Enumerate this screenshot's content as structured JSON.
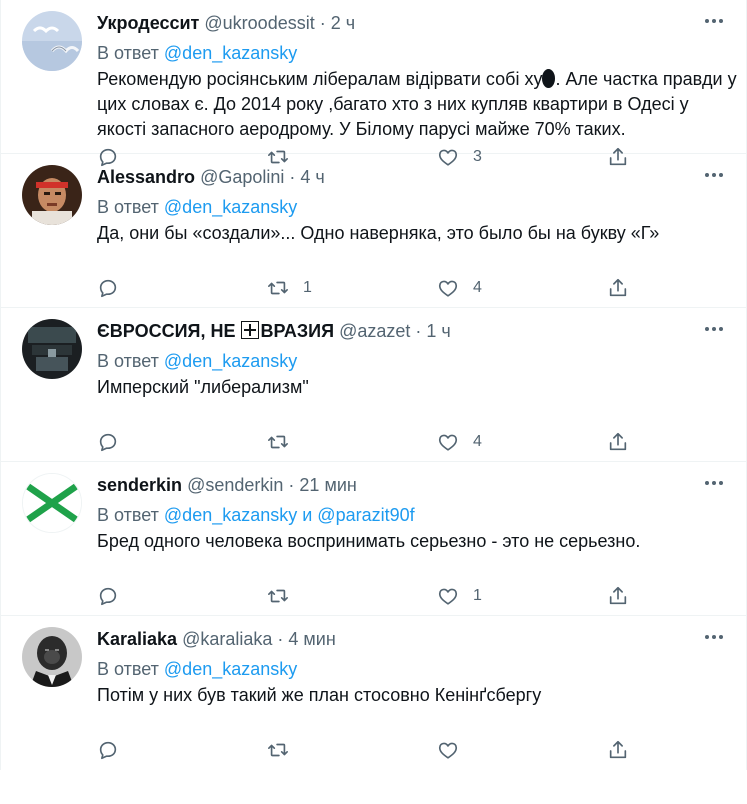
{
  "colors": {
    "accent": "#1d9bf0",
    "secondary_text": "#536471",
    "primary_text": "#0f1419",
    "divider": "#eff3f4"
  },
  "reply_prefix": "В ответ",
  "tweets": [
    {
      "name": "Укродессит",
      "handle": "@ukroodessit",
      "dot": "·",
      "time": "2 ч",
      "mentions": "@den_kazansky",
      "text_part1": "Рекомендую росіянським лібералам відірвати собі ху",
      "text_part2": ". Але частка правди у цих словах є. До 2014 року ,багато хто з них купляв квартири в Одесі у якості запасного аеродрому. У Білому парусі майже 70% таких.",
      "counts": {
        "reply": "",
        "retweet": "",
        "like": "3"
      },
      "avatar_icon": "seagulls-sky-avatar"
    },
    {
      "name": "Alessandro",
      "handle": "@Gapolini",
      "dot": "·",
      "time": "4 ч",
      "mentions": "@den_kazansky",
      "text": "Да, они бы «создали»...  Одно наверняка, это было бы на букву «Г»",
      "counts": {
        "reply": "",
        "retweet": "1",
        "like": "4"
      },
      "avatar_icon": "man-red-headband-avatar"
    },
    {
      "name_part1": "ЄВРОССИЯ, НЕ ",
      "name_part2": "ВРАЗИЯ",
      "handle": "@azazet",
      "dot": "·",
      "time": "1 ч",
      "mentions": "@den_kazansky",
      "text": "Имперский \"либерализм\"",
      "counts": {
        "reply": "",
        "retweet": "",
        "like": "4"
      },
      "avatar_icon": "dark-hall-avatar"
    },
    {
      "name": "senderkin",
      "handle": "@senderkin",
      "dot": "·",
      "time": "21 мин",
      "mentions": "@den_kazansky и @parazit90f",
      "text": "Бред одного человека воспринимать серьезно - это не серьезно.",
      "counts": {
        "reply": "",
        "retweet": "",
        "like": "1"
      },
      "avatar_icon": "green-cross-flag-avatar"
    },
    {
      "name": "Karaliaka",
      "handle": "@karaliaka",
      "dot": "·",
      "time": "4 мин",
      "mentions": "@den_kazansky",
      "text": "Потім у них був такий же план стосовно Кенінґсбергу",
      "counts": {
        "reply": "",
        "retweet": "",
        "like": ""
      },
      "avatar_icon": "gorilla-suit-avatar"
    }
  ]
}
